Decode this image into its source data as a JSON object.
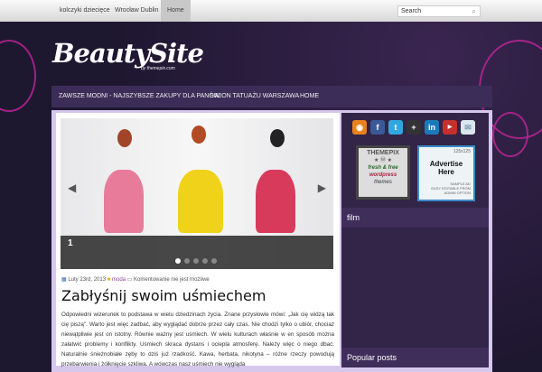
{
  "topbar": {
    "links": [
      "kolczyki dziecięce",
      "Wrocław Dublin",
      "Home"
    ],
    "search_placeholder": "Search"
  },
  "logo": {
    "title": "BeautySite",
    "subtitle": "by themepix.com"
  },
  "nav": [
    "ZAWSZE MODNI - NAJSZYBSZE ZAKUPY DLA PANÓW!",
    "SALON TATUAŻU WARSZAWA",
    "HOME"
  ],
  "slider": {
    "number": "1",
    "dots": 5,
    "active": 0
  },
  "post": {
    "date": "Luty 23rd, 2013",
    "category": "moda",
    "comments": "Komentowanie nie jest możliwe",
    "title": "Zabłyśnij swoim uśmiechem",
    "body": "Odpowiedni wizerunek to podstawa w wielu dziedzinach życia. Znane przysłowie mówi: „Jak cię widzą tak cię piszą\". Warto jest więc zadbać, aby wyglądać dobrze przez cały czas. Nie chodzi tylko o ubiór, chociaż niewątpliwie jest on istotny. Równie ważny jest uśmiech. W wielu kulturach właśnie w en sposób można załatwić problemy i konflikty. Uśmiech skraca dystans i ociepla atmosferę. Należy więc o niego dbać. Naturalnie śnieżnobiałe zęby to dziś już rzadkość. Kawa, herbata, nikotyna – różne rzeczy powodują przebarwienia i żółknięcie szkliwa. A wówczas nasz uśmiech nie wygląda"
  },
  "sidebar": {
    "ad1": {
      "l1": "THEMEPIX",
      "l2": "fresh & free",
      "l3": "wordpress",
      "l4": "themes"
    },
    "ad2": {
      "size": "125x125",
      "title": "Advertise Here",
      "l1": "SAMPLE AD",
      "l2": "EASY EDITABLE FROM",
      "l3": "ADMIN OPTION"
    },
    "widget1": "film",
    "widget2": "Popular posts"
  }
}
